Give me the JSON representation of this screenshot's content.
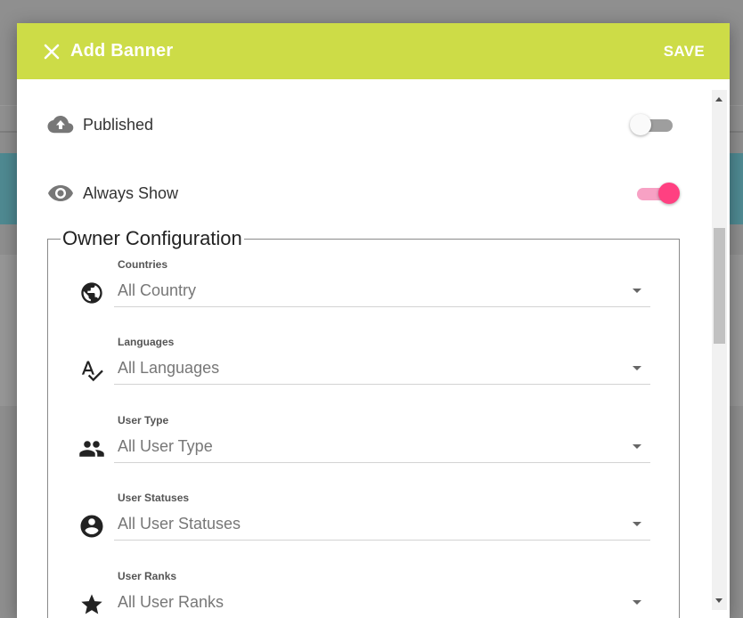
{
  "dialog": {
    "title": "Add Banner",
    "save_label": "SAVE",
    "accent_color": "#cddc47"
  },
  "toggles": [
    {
      "label": "Published",
      "icon": "cloud-upload-icon",
      "state": "off"
    },
    {
      "label": "Always Show",
      "icon": "eye-icon",
      "state": "on",
      "color": "#ff4081"
    }
  ],
  "owner_config": {
    "legend": "Owner Configuration",
    "fields": [
      {
        "caption": "Countries",
        "value": "All Country",
        "icon": "globe-icon"
      },
      {
        "caption": "Languages",
        "value": "All Languages",
        "icon": "spellcheck-icon"
      },
      {
        "caption": "User Type",
        "value": "All User Type",
        "icon": "people-icon"
      },
      {
        "caption": "User Statuses",
        "value": "All User Statuses",
        "icon": "account-circle-icon"
      },
      {
        "caption": "User Ranks",
        "value": "All User Ranks",
        "icon": "star-icon"
      }
    ]
  }
}
